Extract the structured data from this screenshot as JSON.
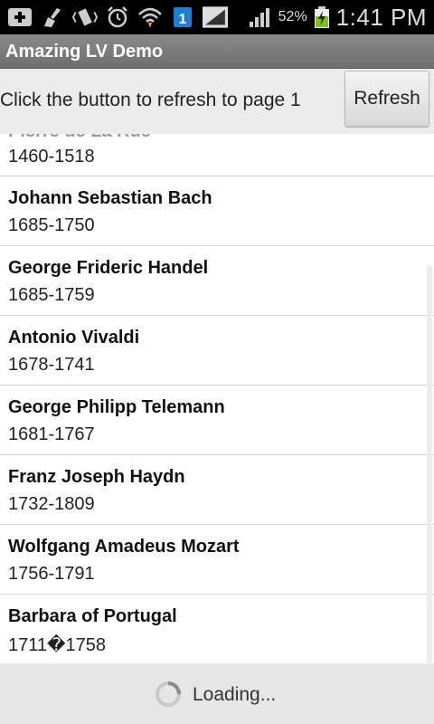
{
  "status_bar": {
    "icons": [
      "add-icon",
      "broom-icon",
      "vibrate-icon",
      "alarm-icon",
      "wifi-icon",
      "sim-one-icon",
      "signal-icon",
      "signal-icon",
      "battery-charging-icon"
    ],
    "battery": "52%",
    "time": "1:41 PM"
  },
  "app": {
    "title": "Amazing LV Demo"
  },
  "header": {
    "message": "Click the button to refresh to page 1",
    "refresh_label": "Refresh"
  },
  "list": {
    "items": [
      {
        "name": "Pierre de La Rue",
        "years": "1460-1518"
      },
      {
        "name": "Johann Sebastian Bach",
        "years": "1685-1750"
      },
      {
        "name": "George Frideric Handel",
        "years": "1685-1759"
      },
      {
        "name": "Antonio Vivaldi",
        "years": "1678-1741"
      },
      {
        "name": "George Philipp Telemann",
        "years": "1681-1767"
      },
      {
        "name": "Franz Joseph Haydn",
        "years": "1732-1809"
      },
      {
        "name": "Wolfgang Amadeus Mozart",
        "years": "1756-1791"
      },
      {
        "name": "Barbara of Portugal",
        "years": "1711�1758"
      }
    ]
  },
  "footer": {
    "loading_text": "Loading..."
  }
}
